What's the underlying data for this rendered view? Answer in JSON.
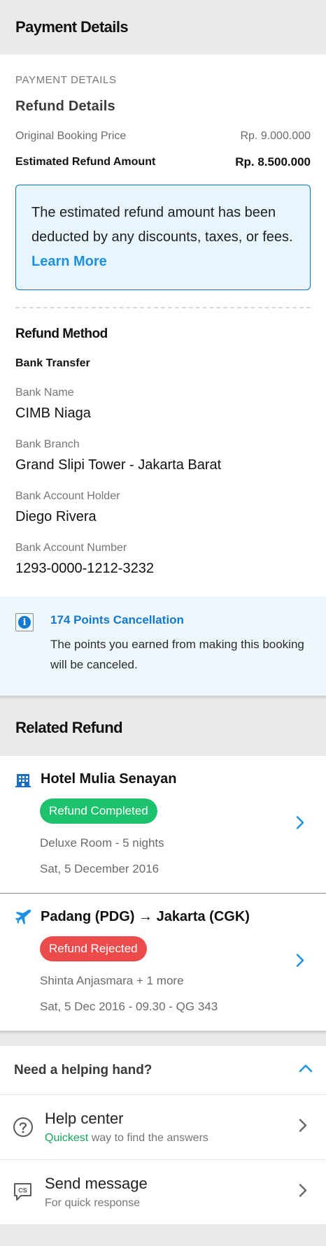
{
  "header": {
    "title": "Payment Details"
  },
  "payment": {
    "overline": "PAYMENT DETAILS",
    "refund_heading": "Refund Details",
    "original_label": "Original Booking Price",
    "original_value": "Rp. 9.000.000",
    "estimated_label": "Estimated Refund Amount",
    "estimated_value": "Rp. 8.500.000",
    "note_text": "The estimated refund amount has been deducted by any discounts, taxes, or fees.",
    "note_link": "Learn More",
    "method_heading": "Refund Method",
    "method_type": "Bank Transfer",
    "fields": [
      {
        "label": "Bank Name",
        "value": "CIMB Niaga"
      },
      {
        "label": "Bank Branch",
        "value": "Grand Slipi Tower - Jakarta Barat"
      },
      {
        "label": "Bank Account Holder",
        "value": "Diego Rivera"
      },
      {
        "label": "Bank Account Number",
        "value": "1293-0000-1212-3232"
      }
    ]
  },
  "points": {
    "icon": "info-icon",
    "title": "174 Points Cancellation",
    "desc": "The points you earned from making this booking will be canceled."
  },
  "related": {
    "title": "Related Refund",
    "items": [
      {
        "icon": "hotel-icon",
        "title": "Hotel Mulia Senayan",
        "status": "Refund Completed",
        "status_color": "#1dc26c",
        "line1": "Deluxe Room - 5 nights",
        "line2": "Sat, 5 December 2016"
      },
      {
        "icon": "plane-icon",
        "title": "Padang (PDG) → Jakarta (CGK)",
        "status": "Refund Rejected",
        "status_color": "#ec4b4b",
        "line1": "Shinta Anjasmara + 1 more",
        "line2": "Sat, 5 Dec 2016 - 09.30 - QG 343"
      }
    ]
  },
  "help": {
    "question": "Need a helping hand?",
    "items": [
      {
        "icon": "help-circle-icon",
        "title": "Help center",
        "sub_highlight": "Quickest",
        "sub_rest": " way to find the answers"
      },
      {
        "icon": "chat-cs-icon",
        "title": "Send message",
        "sub_highlight": "",
        "sub_rest": "For quick response"
      }
    ]
  },
  "colors": {
    "accent": "#1b91e4",
    "primary_blue": "#1279d0",
    "success": "#1dc26c",
    "danger": "#ec4b4b"
  }
}
